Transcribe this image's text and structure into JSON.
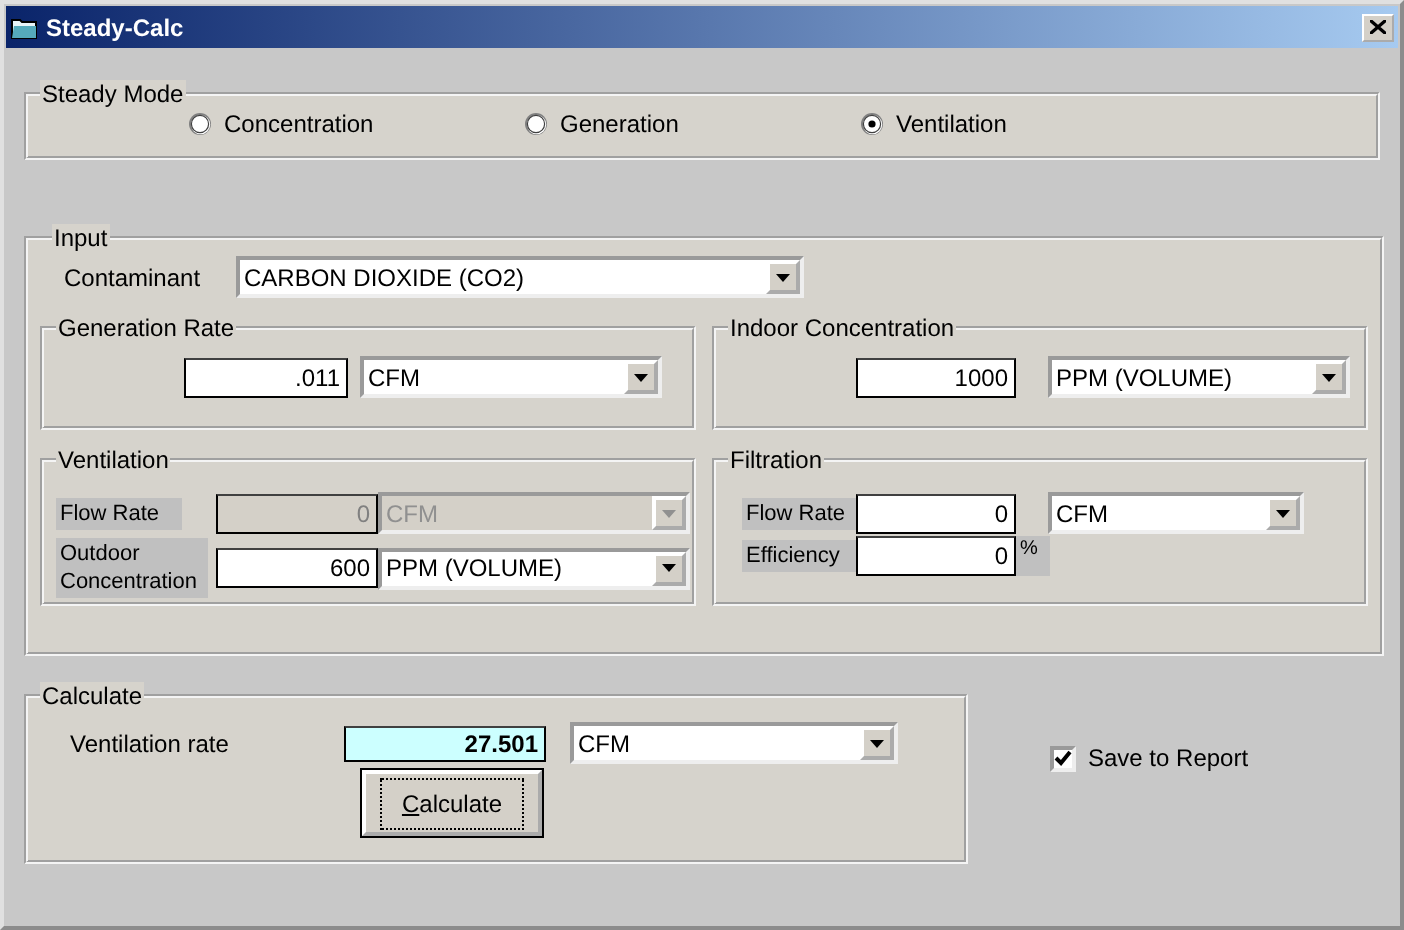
{
  "window": {
    "title": "Steady-Calc"
  },
  "steady_mode": {
    "title": "Steady Mode",
    "options": [
      {
        "label": "Concentration",
        "selected": false
      },
      {
        "label": "Generation",
        "selected": false
      },
      {
        "label": "Ventilation",
        "selected": true
      }
    ]
  },
  "input": {
    "title": "Input",
    "contaminant": {
      "label": "Contaminant",
      "value": "CARBON DIOXIDE (CO2)"
    },
    "generation_rate": {
      "title": "Generation Rate",
      "value": ".011",
      "unit": "CFM"
    },
    "indoor_concentration": {
      "title": "Indoor Concentration",
      "value": "1000",
      "unit": "PPM (VOLUME)"
    },
    "ventilation": {
      "title": "Ventilation",
      "flow_rate": {
        "label": "Flow Rate",
        "value": "0",
        "unit": "CFM",
        "disabled": true
      },
      "outdoor_concentration": {
        "label": "Outdoor Concentration",
        "value": "600",
        "unit": "PPM (VOLUME)",
        "disabled": false
      }
    },
    "filtration": {
      "title": "Filtration",
      "flow_rate": {
        "label": "Flow Rate",
        "value": "0",
        "unit": "CFM"
      },
      "efficiency": {
        "label": "Efficiency",
        "value": "0",
        "suffix": "%"
      }
    }
  },
  "calculate": {
    "title": "Calculate",
    "result": {
      "label": "Ventilation rate",
      "value": "27.501",
      "unit": "CFM"
    },
    "button": "Calculate"
  },
  "save_to_report": {
    "label": "Save to Report",
    "checked": true
  }
}
